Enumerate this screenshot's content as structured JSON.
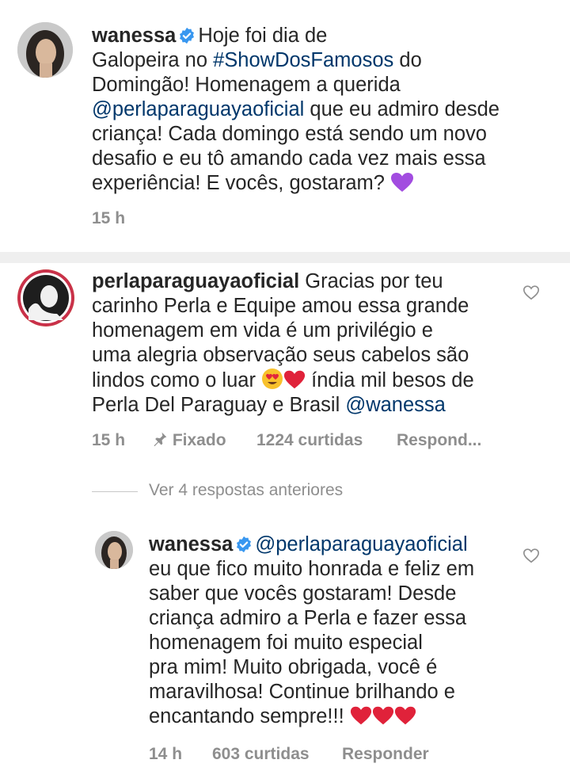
{
  "post": {
    "username": "wanessa",
    "caption_part1": "Hoje foi dia de",
    "caption_line2_a": "Galopeira no ",
    "caption_hashtag": "#ShowDosFamosos",
    "caption_line2_b": " do",
    "caption_line3": "Domingão! Homenagem a querida",
    "caption_mention": "@perlaparaguayaoficial",
    "caption_line4_b": " que eu admiro desde",
    "caption_line5": "criança! Cada domingo está sendo um novo",
    "caption_line6": "desafio e eu tô amando cada vez mais essa",
    "caption_line7": "experiência! E vocês, gostaram?",
    "time": "15 h"
  },
  "comment": {
    "username": "perlaparaguayaoficial",
    "line1_b": " Gracias por teu",
    "line2": "carinho Perla e Equipe amou essa grande",
    "line3": "homenagem em vida é um privilégio e",
    "line4": "uma  alegria observação seus cabelos são",
    "line5_a": "lindos como o luar ",
    "line5_b": " índia mil besos de",
    "line6_a": "Perla Del Paraguay e Brasil ",
    "line6_mention": "@wanessa",
    "time": "15 h",
    "pinned": "Fixado",
    "likes": "1224 curtidas",
    "reply": "Respond..."
  },
  "view_replies": "Ver 4 respostas anteriores",
  "reply": {
    "username": "wanessa",
    "mention": "@perlaparaguayaoficial",
    "line2": "eu que fico muito honrada e feliz em",
    "line3": "saber que vocês gostaram! Desde",
    "line4": "criança admiro a Perla e fazer essa",
    "line5": "homenagem foi muito especial",
    "line6": "pra mim! Muito obrigada, você é",
    "line7": "maravilhosa! Continue brilhando e",
    "line8": "encantando sempre!!!",
    "time": "14 h",
    "likes": "603 curtidas",
    "reply": "Responder"
  },
  "colors": {
    "text": "#262626",
    "meta": "#8e8e8e",
    "link": "#00376b",
    "verified": "#3897f0"
  }
}
